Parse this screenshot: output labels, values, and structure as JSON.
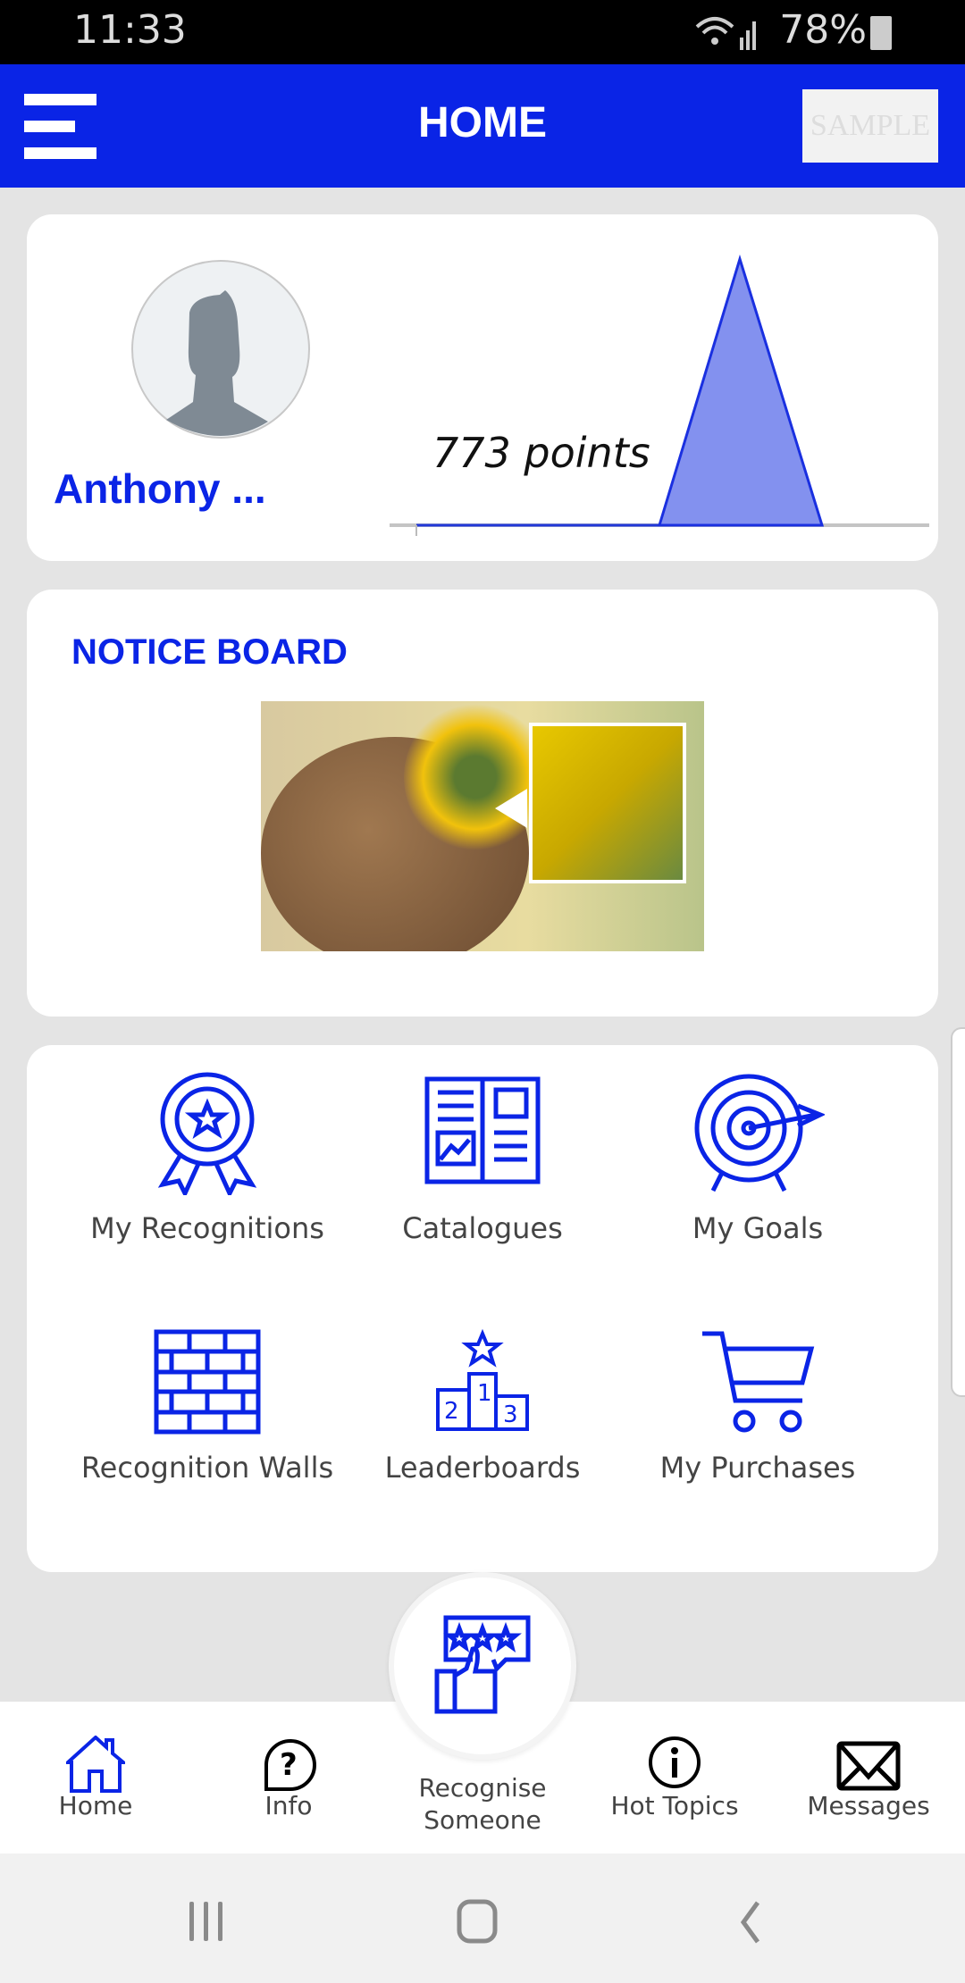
{
  "status_bar": {
    "time": "11:33",
    "battery": "78%"
  },
  "header": {
    "title": "HOME",
    "logo_text": "SAMPLE",
    "accent": "#0a24e6"
  },
  "profile": {
    "name": "Anthony ...",
    "points_label": "773 points",
    "points": 773
  },
  "notice_board": {
    "title": "NOTICE BOARD"
  },
  "tiles": [
    {
      "label": "My Recognitions",
      "icon": "award-ribbon-icon"
    },
    {
      "label": "Catalogues",
      "icon": "open-book-icon"
    },
    {
      "label": "My Goals",
      "icon": "target-icon"
    },
    {
      "label": "Recognition Walls",
      "icon": "brick-wall-icon"
    },
    {
      "label": "Leaderboards",
      "icon": "podium-icon"
    },
    {
      "label": "My Purchases",
      "icon": "cart-icon"
    }
  ],
  "bottom_nav": {
    "home": "Home",
    "info": "Info",
    "recognise_line1": "Recognise",
    "recognise_line2": "Someone",
    "hot_topics": "Hot Topics",
    "messages": "Messages"
  }
}
